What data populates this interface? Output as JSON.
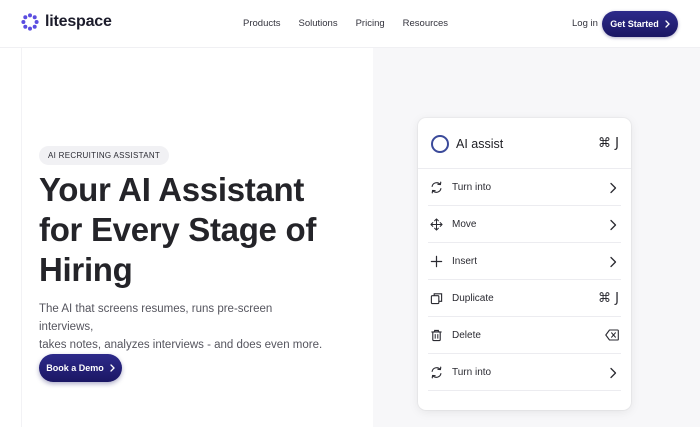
{
  "brand": {
    "name": "litespace",
    "accent": "#5b4de0",
    "primary_button": "#1f1a6e"
  },
  "nav": {
    "items": [
      "Products",
      "Solutions",
      "Pricing",
      "Resources"
    ]
  },
  "header": {
    "login_label": "Log in",
    "cta_label": "Get Started"
  },
  "hero": {
    "badge": "AI RECRUITING ASSISTANT",
    "title_line1": "Your AI Assistant",
    "title_line2": "for Every Stage of",
    "title_line3": "Hiring",
    "subtitle_line1": "The AI that screens resumes, runs pre-screen interviews,",
    "subtitle_line2": "takes notes, analyzes interviews - and does even more.",
    "demo_label": "Book a Demo"
  },
  "menu": {
    "title": "AI assist",
    "title_shortcut": "⌘ J",
    "items": [
      {
        "label": "Turn into",
        "icon": "refresh-icon",
        "trailing": "chevron"
      },
      {
        "label": "Move",
        "icon": "move-icon",
        "trailing": "chevron"
      },
      {
        "label": "Insert",
        "icon": "plus-icon",
        "trailing": "chevron"
      },
      {
        "label": "Duplicate",
        "icon": "copy-icon",
        "trailing": "shortcut",
        "shortcut": "⌘ J"
      },
      {
        "label": "Delete",
        "icon": "trash-icon",
        "trailing": "backspace"
      },
      {
        "label": "Turn into",
        "icon": "refresh-icon",
        "trailing": "chevron"
      }
    ]
  }
}
